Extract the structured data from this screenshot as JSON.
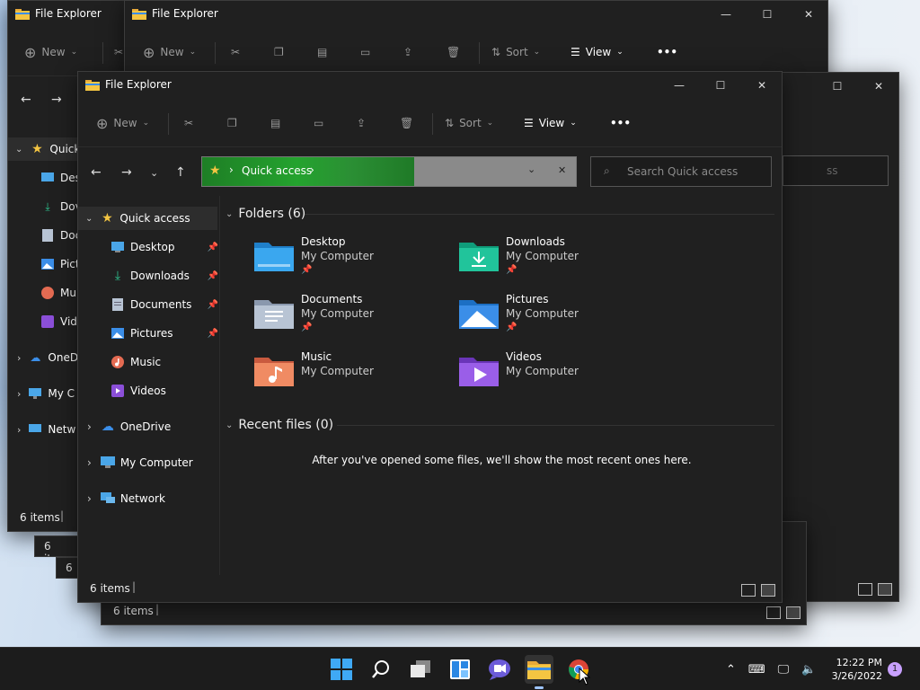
{
  "windows": {
    "title": "File Explorer",
    "status_items": "6 items"
  },
  "toolbar": {
    "new_label": "New",
    "sort_label": "Sort",
    "view_label": "View",
    "more_label": "•••"
  },
  "back_window": {
    "sidebar": [
      "Quick",
      "Des",
      "Dov",
      "Doc",
      "Pict",
      "Mu",
      "Vide",
      "OneD",
      "My C",
      "Netw"
    ],
    "search_tail": "ss"
  },
  "address": {
    "breadcrumb": "Quick access",
    "search_placeholder": "Search Quick access"
  },
  "sidebar": {
    "items": [
      {
        "label": "Quick access",
        "icon": "star-icon",
        "expanded": true,
        "pinned": false
      },
      {
        "label": "Desktop",
        "icon": "desktop-icon",
        "pinned": true
      },
      {
        "label": "Downloads",
        "icon": "download-icon",
        "pinned": true
      },
      {
        "label": "Documents",
        "icon": "document-icon",
        "pinned": true
      },
      {
        "label": "Pictures",
        "icon": "pictures-icon",
        "pinned": true
      },
      {
        "label": "Music",
        "icon": "music-icon",
        "pinned": false
      },
      {
        "label": "Videos",
        "icon": "video-icon",
        "pinned": false
      },
      {
        "label": "OneDrive",
        "icon": "cloud-icon",
        "pinned": false
      },
      {
        "label": "My Computer",
        "icon": "computer-icon",
        "pinned": false
      },
      {
        "label": "Network",
        "icon": "network-icon",
        "pinned": false
      }
    ]
  },
  "main": {
    "folders_header": "Folders (6)",
    "recent_header": "Recent files (0)",
    "empty_message": "After you've opened some files, we'll show the most recent ones here.",
    "folders": [
      {
        "name": "Desktop",
        "location": "My Computer",
        "pinned": true,
        "icon": "desktop-folder-icon"
      },
      {
        "name": "Downloads",
        "location": "My Computer",
        "pinned": true,
        "icon": "downloads-folder-icon"
      },
      {
        "name": "Documents",
        "location": "My Computer",
        "pinned": true,
        "icon": "documents-folder-icon"
      },
      {
        "name": "Pictures",
        "location": "My Computer",
        "pinned": true,
        "icon": "pictures-folder-icon"
      },
      {
        "name": "Music",
        "location": "My Computer",
        "pinned": false,
        "icon": "music-folder-icon"
      },
      {
        "name": "Videos",
        "location": "My Computer",
        "pinned": false,
        "icon": "videos-folder-icon"
      }
    ]
  },
  "taskbar": {
    "time": "12:22 PM",
    "date": "3/26/2022",
    "notification_count": "1",
    "apps": [
      "start-icon",
      "search-icon",
      "task-view-icon",
      "widgets-icon",
      "chat-icon",
      "file-explorer-icon",
      "chrome-icon"
    ]
  },
  "colors": {
    "accent": "#2b8f34",
    "bg": "#202020",
    "folder_yellow": "#f4c542"
  }
}
